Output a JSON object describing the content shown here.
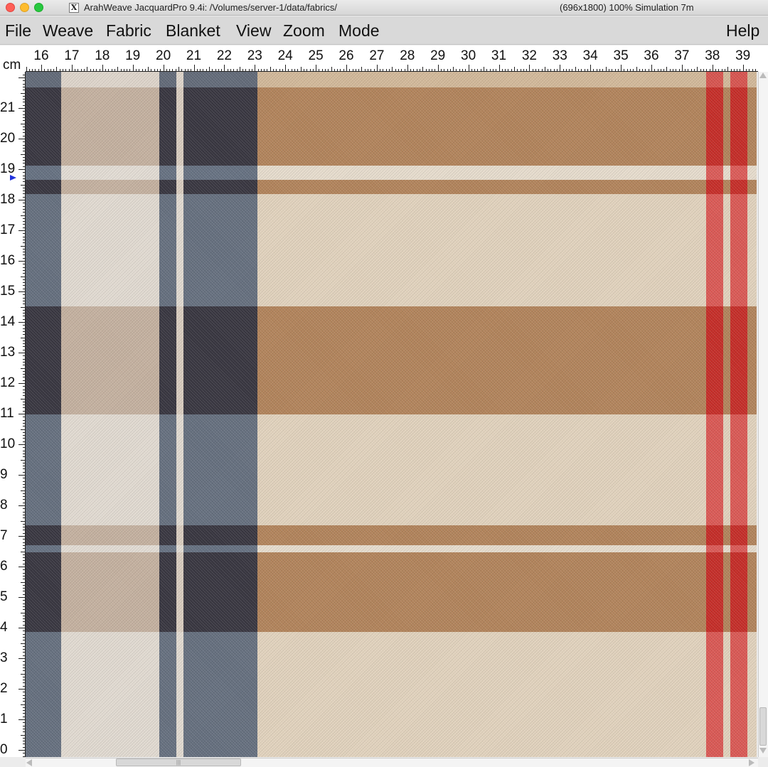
{
  "window": {
    "title": "ArahWeave JacquardPro 9.4i: /Volumes/server-1/data/fabrics/",
    "status": "(696x1800) 100% Simulation 7m",
    "x_icon": "X"
  },
  "menu": {
    "file": "File",
    "weave": "Weave",
    "fabric": "Fabric",
    "blanket": "Blanket",
    "view": "View",
    "zoom": "Zoom",
    "mode": "Mode",
    "help": "Help"
  },
  "ruler": {
    "unit": "cm",
    "x_numbers": [
      "16",
      "17",
      "18",
      "19",
      "20",
      "21",
      "22",
      "23",
      "24",
      "25",
      "26",
      "27",
      "28",
      "29",
      "30",
      "31",
      "32",
      "33",
      "34",
      "35",
      "36",
      "37",
      "38",
      "39"
    ],
    "y_numbers": [
      "21",
      "20",
      "19",
      "18",
      "17",
      "16",
      "15",
      "14",
      "13",
      "12",
      "11",
      "10",
      "9",
      "8",
      "7",
      "6",
      "5",
      "4",
      "3",
      "2",
      "1",
      "0"
    ],
    "position_marker": "blue-triangle-marker"
  },
  "scrollbars": {
    "h_thumb_grip": "|||"
  },
  "colors": {
    "fabric_tan": "#d2b99a",
    "fabric_brown": "#b2845c",
    "navy": "#4a5a72",
    "charcoal": "#2e2a33",
    "cream": "#e0dcd6",
    "red": "#d84040"
  },
  "icons": {
    "close": "close-traffic-light-icon",
    "minimize": "minimize-traffic-light-icon",
    "maximize": "maximize-traffic-light-icon",
    "x11": "x11-app-icon"
  }
}
